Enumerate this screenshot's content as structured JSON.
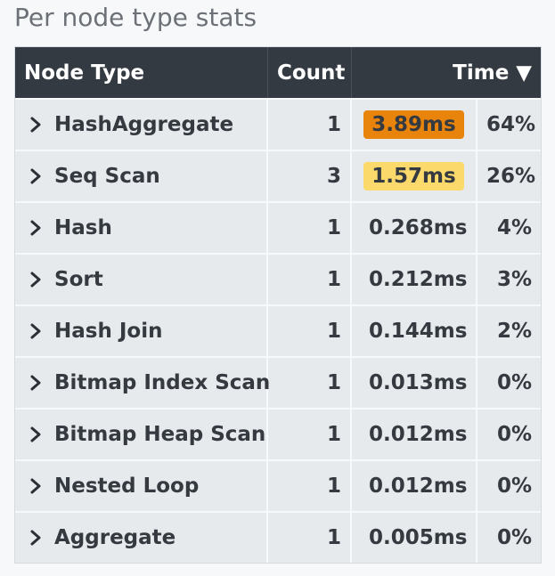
{
  "title": "Per node type stats",
  "headers": {
    "node_type": "Node Type",
    "count": "Count",
    "time": "Time ▼"
  },
  "colors": {
    "header_bg": "#343a42",
    "row_bg": "#e7eaed",
    "highlight_high": "#e8830c",
    "highlight_medium": "#fbd96b"
  },
  "rows": [
    {
      "name": "HashAggregate",
      "count": "1",
      "time": "3.89ms",
      "percent": "64%",
      "highlight": "high"
    },
    {
      "name": "Seq Scan",
      "count": "3",
      "time": "1.57ms",
      "percent": "26%",
      "highlight": "medium"
    },
    {
      "name": "Hash",
      "count": "1",
      "time": "0.268ms",
      "percent": "4%",
      "highlight": "none"
    },
    {
      "name": "Sort",
      "count": "1",
      "time": "0.212ms",
      "percent": "3%",
      "highlight": "none"
    },
    {
      "name": "Hash Join",
      "count": "1",
      "time": "0.144ms",
      "percent": "2%",
      "highlight": "none"
    },
    {
      "name": "Bitmap Index Scan",
      "count": "1",
      "time": "0.013ms",
      "percent": "0%",
      "highlight": "none"
    },
    {
      "name": "Bitmap Heap Scan",
      "count": "1",
      "time": "0.012ms",
      "percent": "0%",
      "highlight": "none"
    },
    {
      "name": "Nested Loop",
      "count": "1",
      "time": "0.012ms",
      "percent": "0%",
      "highlight": "none"
    },
    {
      "name": "Aggregate",
      "count": "1",
      "time": "0.005ms",
      "percent": "0%",
      "highlight": "none"
    }
  ]
}
